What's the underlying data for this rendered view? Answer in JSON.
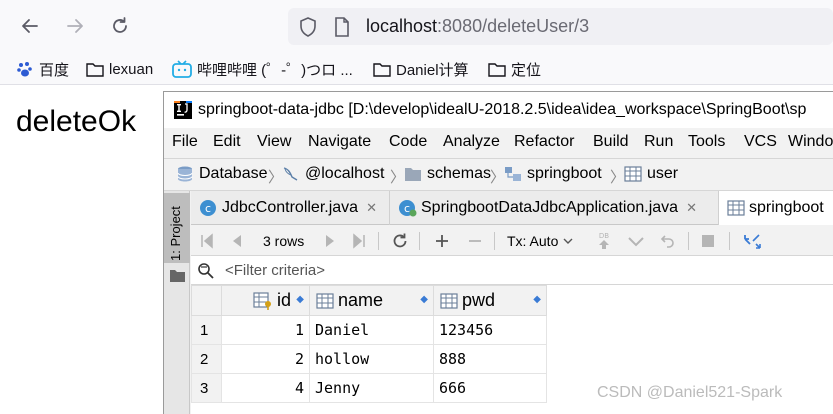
{
  "browser": {
    "url_host": "localhost",
    "url_rest": ":8080/deleteUser/3",
    "bookmarks": [
      "百度",
      "lexuan",
      "哔哩哔哩 (゜-゜)つロ ...",
      "Daniel计算",
      "定位"
    ]
  },
  "page": {
    "text": "deleteOk"
  },
  "ide": {
    "title": "springboot-data-jdbc [D:\\develop\\idealU-2018.2.5\\idea\\idea_workspace\\SpringBoot\\sp",
    "menu": [
      "File",
      "Edit",
      "View",
      "Navigate",
      "Code",
      "Analyze",
      "Refactor",
      "Build",
      "Run",
      "Tools",
      "VCS",
      "Windo"
    ],
    "breadcrumb": [
      "Database",
      "@localhost",
      "schemas",
      "springboot",
      "user"
    ],
    "side_tab": "1: Project",
    "tabs": [
      "JdbcController.java",
      "SpringbootDataJdbcApplication.java",
      "springboot"
    ],
    "toolbar": {
      "rows": "3 rows",
      "tx": "Tx: Auto"
    },
    "filter_placeholder": "<Filter criteria>",
    "table": {
      "columns": [
        "id",
        "name",
        "pwd"
      ],
      "rows": [
        {
          "n": "1",
          "id": "1",
          "name": "Daniel",
          "pwd": "123456"
        },
        {
          "n": "2",
          "id": "2",
          "name": "hollow",
          "pwd": "888"
        },
        {
          "n": "3",
          "id": "4",
          "name": "Jenny",
          "pwd": "666"
        }
      ]
    }
  },
  "watermark": "CSDN @Daniel521-Spark",
  "colors": {
    "accent": "#3a7bd5",
    "java_icon": "#3d8fd1"
  }
}
